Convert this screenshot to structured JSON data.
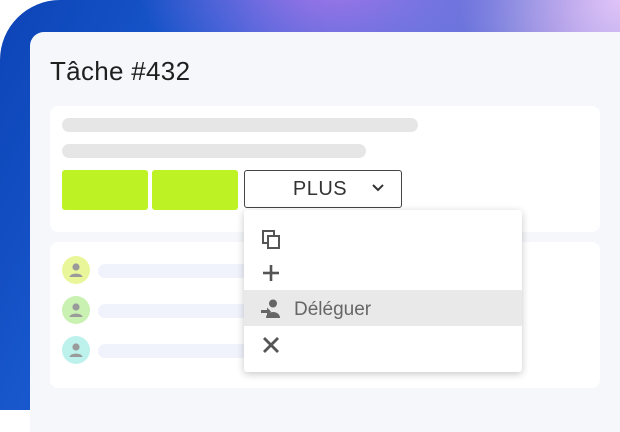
{
  "task": {
    "title": "Tâche #432"
  },
  "toolbar": {
    "more_label": "PLUS"
  },
  "menu": {
    "items": [
      {
        "icon": "copy-icon",
        "label": ""
      },
      {
        "icon": "plus-icon",
        "label": ""
      },
      {
        "icon": "delegate-icon",
        "label": "Déléguer",
        "highlighted": true
      },
      {
        "icon": "close-icon",
        "label": ""
      }
    ]
  },
  "assignees": [
    {
      "avatar_color": "#e9f79a"
    },
    {
      "avatar_color": "#c9f1b1"
    },
    {
      "avatar_color": "#bdf2ec"
    }
  ],
  "colors": {
    "action_green": "#bdf225",
    "accent": "#2a5bd7"
  }
}
